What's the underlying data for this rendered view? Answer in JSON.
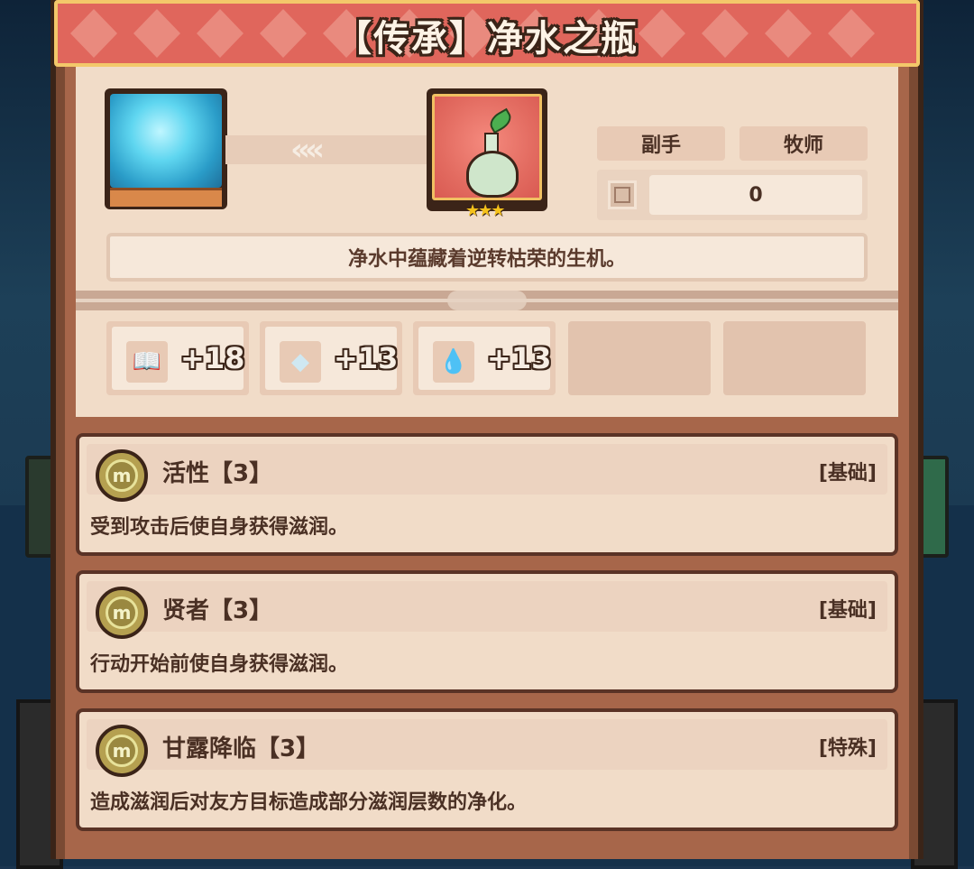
{
  "header": {
    "title": "【传承】净水之瓶"
  },
  "item": {
    "slot_tag": "副手",
    "class_tag": "牧师",
    "stat_value": "0",
    "description": "净水中蕴藏着逆转枯荣的生机。",
    "stars": "★★★"
  },
  "bonuses": [
    {
      "icon": "book-icon",
      "glyph": "📖",
      "value": "+18"
    },
    {
      "icon": "crystal-icon",
      "glyph": "◆",
      "value": "+13"
    },
    {
      "icon": "water-drop-icon",
      "glyph": "💧",
      "value": "+13"
    }
  ],
  "traits": [
    {
      "name": "活性【3】",
      "type": "[基础]",
      "desc": "受到攻击后使自身获得滋润。",
      "coin": "m"
    },
    {
      "name": "贤者【3】",
      "type": "[基础]",
      "desc": "行动开始前使自身获得滋润。",
      "coin": "m"
    },
    {
      "name": "甘露降临【3】",
      "type": "[特殊]",
      "desc": "造成滋润后对友方目标造成部分滋润层数的净化。",
      "coin": "m"
    }
  ],
  "colors": {
    "banner": "#e0665c",
    "card": "#f1dcc8",
    "frame": "#7a4a33"
  }
}
